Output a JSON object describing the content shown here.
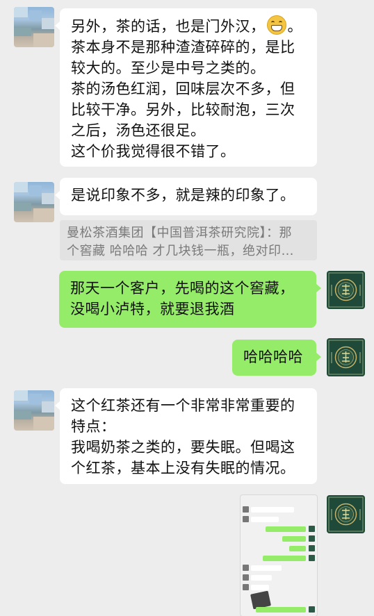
{
  "messages": [
    {
      "side": "left",
      "lines": [
        "另外，茶的话，也是门外汉，",
        "茶本身不是那种渣渣碎碎的，是比",
        "较大的。至少是中号之类的。",
        "茶的汤色红润，回味层次不多，但",
        "比较干净。另外，比较耐泡，三次",
        "之后，汤色还很足。",
        "这个价我觉得很不错了。"
      ],
      "first_line_tail": "。"
    },
    {
      "side": "left",
      "lines": [
        "是说印象不多，就是辣的印象了。"
      ],
      "quote_lines": [
        "曼松茶酒集团【中国普洱茶研究院】：那",
        "个窖藏 哈哈哈 才几块钱一瓶，绝对印…"
      ]
    },
    {
      "side": "right",
      "lines": [
        "那天一个客户，先喝的这个窖藏，",
        "没喝小泸特，就要退我酒"
      ]
    },
    {
      "side": "right",
      "lines": [
        "哈哈哈哈"
      ]
    },
    {
      "side": "left",
      "lines": [
        "这个红茶还有一个非常非常重要的",
        "特点：",
        "我喝奶茶之类的，要失眠。但喝这",
        "个红茶，基本上没有失眠的情况。"
      ]
    },
    {
      "side": "right",
      "type": "image",
      "image_desc": "chat-screenshot-thumbnail"
    }
  ],
  "icons": {
    "emoji": "grinning-face-icon",
    "avatar_right": "tea-brand-logo-icon"
  },
  "colors": {
    "background": "#ededed",
    "bubble_self": "#95ec69",
    "bubble_other": "#ffffff",
    "quote_bg": "#e2e2e2",
    "logo_bg": "#1f4a3a"
  }
}
